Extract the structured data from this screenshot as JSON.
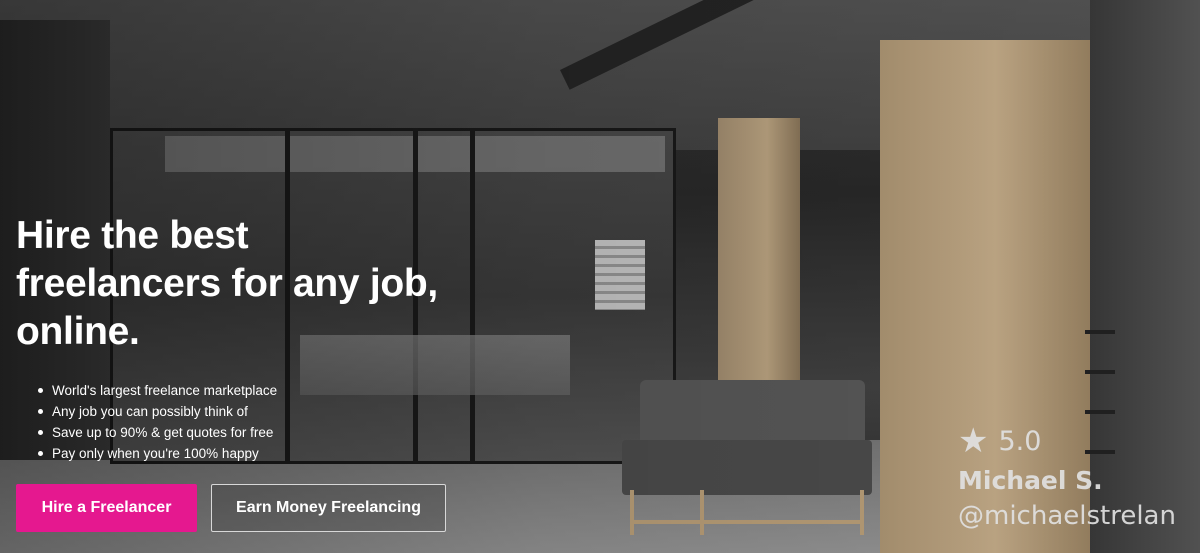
{
  "hero": {
    "headline_line1": "Hire the best",
    "headline_line2": "freelancers for any job,",
    "headline_line3": "online.",
    "features": [
      "World's largest freelance marketplace",
      "Any job you can possibly think of",
      "Save up to 90% & get quotes for free",
      "Pay only when you're 100% happy"
    ],
    "hire_button_label": "Hire a Freelancer",
    "earn_button_label": "Earn Money Freelancing"
  },
  "attribution": {
    "star_icon": "star-icon",
    "rating": "5.0",
    "name": "Michael S.",
    "handle": "@michaelstrelan"
  },
  "colors": {
    "primary_button": "#e5188f",
    "text": "#ffffff"
  }
}
